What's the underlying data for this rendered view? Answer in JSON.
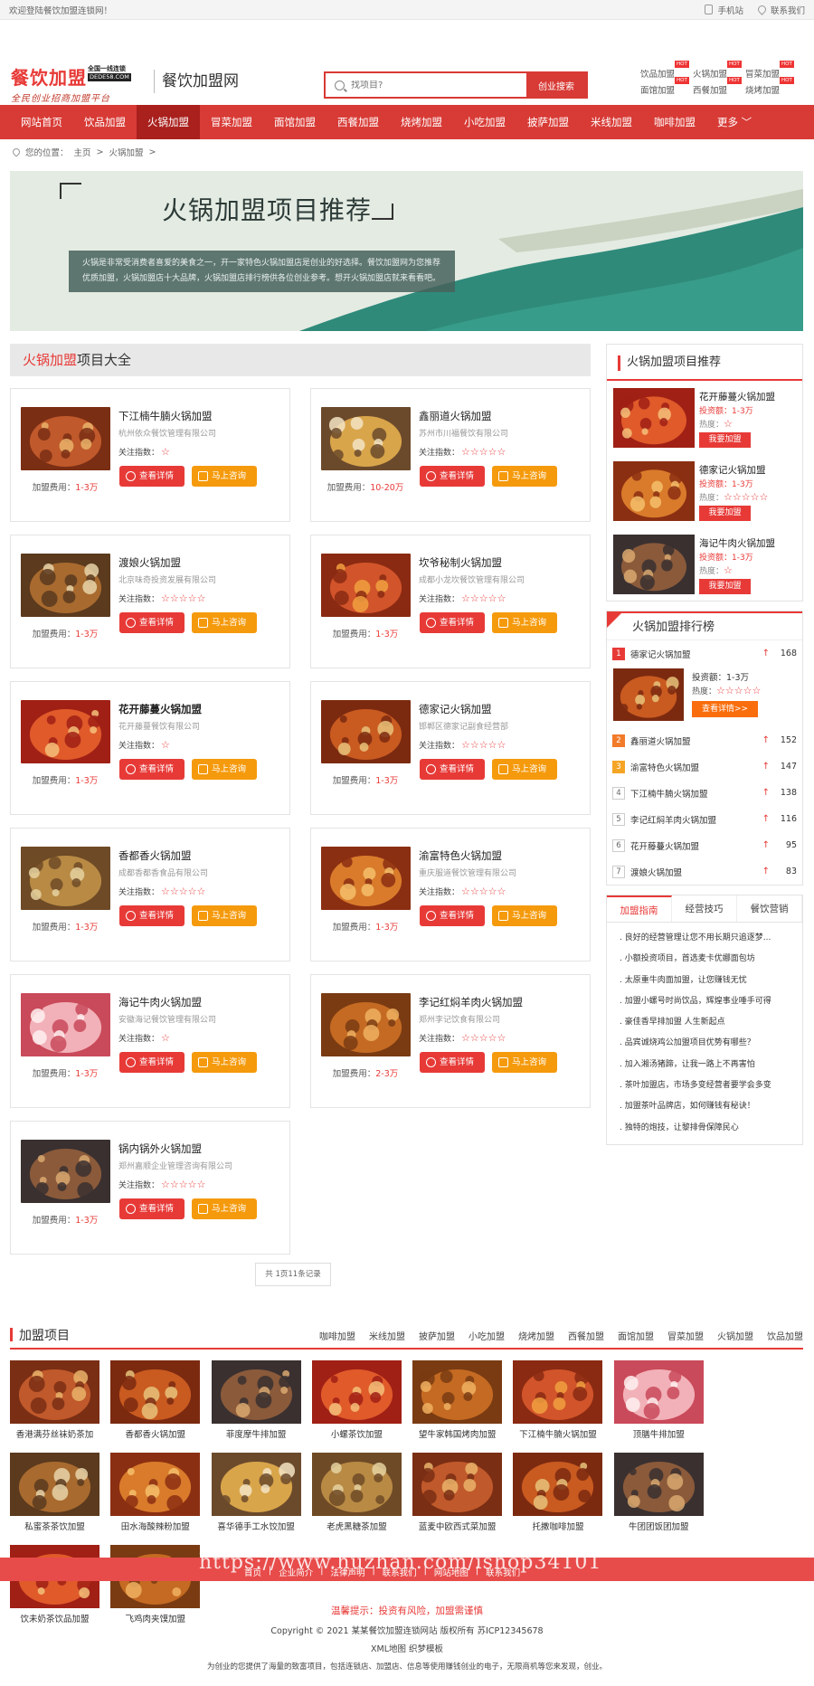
{
  "topbar": {
    "welcome": "欢迎登陆餐饮加盟连锁网！",
    "mobile": "手机站",
    "contact": "联系我们"
  },
  "header": {
    "logo_main": "餐饮加盟",
    "logo_tag1": "全国一线连锁",
    "logo_tag2": "DEDE58.COM",
    "logo_slogan": "全民创业招商加盟平台",
    "site_name": "餐饮加盟网",
    "search_placeholder": "找项目?",
    "search_button": "创业搜索",
    "hot": [
      {
        "label": "饮品加盟",
        "hot": "HOT"
      },
      {
        "label": "火锅加盟",
        "hot": "HOT"
      },
      {
        "label": "冒菜加盟",
        "hot": "HOT"
      },
      {
        "label": "面馆加盟",
        "hot": "HOT"
      },
      {
        "label": "西餐加盟",
        "hot": "HOT"
      },
      {
        "label": "烧烤加盟",
        "hot": "HOT"
      }
    ]
  },
  "nav": [
    {
      "label": "网站首页"
    },
    {
      "label": "饮品加盟"
    },
    {
      "label": "火锅加盟",
      "active": true
    },
    {
      "label": "冒菜加盟"
    },
    {
      "label": "面馆加盟"
    },
    {
      "label": "西餐加盟"
    },
    {
      "label": "烧烤加盟"
    },
    {
      "label": "小吃加盟"
    },
    {
      "label": "披萨加盟"
    },
    {
      "label": "米线加盟"
    },
    {
      "label": "咖啡加盟"
    },
    {
      "label": "更多 ﹀"
    }
  ],
  "breadcrumb": {
    "prefix": "您的位置：",
    "home": "主页",
    "sep": ">",
    "current": "火锅加盟",
    "tail": ">"
  },
  "banner": {
    "title": "火锅加盟项目推荐",
    "desc": "火锅是非常受消费者喜爱的美食之一，开一家特色火锅加盟店是创业的好选择。餐饮加盟网为您推荐优质加盟，火锅加盟店十大品牌，火锅加盟店排行榜供各位创业参考。想开火锅加盟店就来看看吧。"
  },
  "list": {
    "head_red": "火锅加盟",
    "head_rest": "项目大全",
    "attention": "关注指数：",
    "fee_label": "加盟费用：",
    "btn_detail": "查看详情",
    "btn_consult": "马上咨询",
    "items": [
      {
        "name": "下江楠牛腩火锅加盟",
        "company": "杭州依众餐饮管理有限公司",
        "fee": "1-3万",
        "stars": 1,
        "bold": false
      },
      {
        "name": "鑫丽道火锅加盟",
        "company": "苏州市川福餐饮有限公司",
        "fee": "10-20万",
        "stars": 5,
        "bold": false
      },
      {
        "name": "渡娘火锅加盟",
        "company": "北京味奇投资发展有限公司",
        "fee": "1-3万",
        "stars": 5,
        "bold": false
      },
      {
        "name": "坎爷秘制火锅加盟",
        "company": "成都小龙坎餐饮管理有限公司",
        "fee": "1-3万",
        "stars": 5,
        "bold": false
      },
      {
        "name": "花开藤蔓火锅加盟",
        "company": "花开藤蔓餐饮有限公司",
        "fee": "1-3万",
        "stars": 1,
        "bold": true
      },
      {
        "name": "德家记火锅加盟",
        "company": "邯郸区德家记副食经营部",
        "fee": "1-3万",
        "stars": 5,
        "bold": false
      },
      {
        "name": "香都香火锅加盟",
        "company": "成都香都香食品有限公司",
        "fee": "1-3万",
        "stars": 5,
        "bold": false
      },
      {
        "name": "渝富特色火锅加盟",
        "company": "重庆服道餐饮管理有限公司",
        "fee": "1-3万",
        "stars": 5,
        "bold": false
      },
      {
        "name": "海记牛肉火锅加盟",
        "company": "安徽海记餐饮管理有限公司",
        "fee": "1-3万",
        "stars": 1,
        "bold": false
      },
      {
        "name": "李记红焖羊肉火锅加盟",
        "company": "郑州李记饮食有限公司",
        "fee": "2-3万",
        "stars": 5,
        "bold": false
      },
      {
        "name": "锅内锅外火锅加盟",
        "company": "郑州嘉顺企业管理咨询有限公司",
        "fee": "1-3万",
        "stars": 5,
        "bold": false
      }
    ],
    "pager": "共 1页11条记录"
  },
  "recommend": {
    "title": "火锅加盟项目推荐",
    "invest": "投资额：",
    "heat": "热度：",
    "join": "我要加盟",
    "items": [
      {
        "name": "花开藤蔓火锅加盟",
        "amount": "1-3万",
        "stars": 1
      },
      {
        "name": "德家记火锅加盟",
        "amount": "1-3万",
        "stars": 5
      },
      {
        "name": "海记牛肉火锅加盟",
        "amount": "1-3万",
        "stars": 1
      }
    ]
  },
  "ranking": {
    "title": "火锅加盟排行榜",
    "flag": "TOP",
    "feature_invest": "投资额：1-3万",
    "feature_heat": "热度：",
    "feature_btn": "查看详情>>",
    "items": [
      {
        "no": "1",
        "name": "德家记火锅加盟",
        "val": "168"
      },
      {
        "no": "2",
        "name": "鑫丽道火锅加盟",
        "val": "152"
      },
      {
        "no": "3",
        "name": "渝富特色火锅加盟",
        "val": "147"
      },
      {
        "no": "4",
        "name": "下江楠牛腩火锅加盟",
        "val": "138"
      },
      {
        "no": "5",
        "name": "李记红焖羊肉火锅加盟",
        "val": "116"
      },
      {
        "no": "6",
        "name": "花开藤蔓火锅加盟",
        "val": "95"
      },
      {
        "no": "7",
        "name": "渡娘火锅加盟",
        "val": "83"
      }
    ]
  },
  "tabs": {
    "labels": [
      "加盟指南",
      "经营技巧",
      "餐饮营销"
    ],
    "articles": [
      "良好的经营管理让您不用长期只追逐梦...",
      "小额投资项目，首选麦卡优娜面包坊",
      "太原重牛肉面加盟，让您赚钱无忧",
      "加盟小螺号时尚饮品，辉煌事业唾手可得",
      "豪佳香早排加盟 人生新起点",
      "品宾诚烧鸡公加盟项目优势有哪些？",
      "加入湘汤猪蹄，让我一路上不再害怕",
      "茶叶加盟店，市场多变经营者要学会多变",
      "加盟茶叶品牌店，如何赚钱有秘诀！",
      "独特的炮技，让黎排骨保障民心"
    ]
  },
  "bottom": {
    "title": "加盟项目",
    "links": [
      "咖啡加盟",
      "米线加盟",
      "披萨加盟",
      "小吃加盟",
      "烧烤加盟",
      "西餐加盟",
      "面馆加盟",
      "冒菜加盟",
      "火锅加盟",
      "饮品加盟"
    ],
    "items": [
      "香港满芬丝袜奶茶加",
      "香都香火锅加盟",
      "菲度摩牛排加盟",
      "小螺茶饮加盟",
      "望牛家韩国烤肉加盟",
      "下江楠牛腩火锅加盟",
      "顶膳牛排加盟",
      "私蜜茶茶饮加盟",
      "田水海酸辣粉加盟",
      "喜华德手工水饺加盟",
      "老虎黑糖茶加盟",
      "蓝麦中欧西式菜加盟",
      "托撒咖啡加盟",
      "牛团团饭团加盟",
      "饮未奶茶饮品加盟",
      "飞鸡肉夹馍加盟"
    ]
  },
  "footer": {
    "links": [
      "首页",
      "企业简介",
      "法律声明",
      "联系我们",
      "网站地图",
      "联系我们"
    ],
    "watermark": "https://www.huzhan.com/ishop34101",
    "warn": "温馨提示：投资有风险，加盟需谨慎",
    "copyright": "Copyright © 2021 某某餐饮加盟连锁网站 版权所有 苏ICP12345678",
    "xml": "XML地图 织梦模板",
    "note": "为创业的您提供了海量的致富项目，包括连锁店、加盟店、信息等使用赚钱创业的电子，无限商机等您来发现，创业。"
  },
  "colors": {
    "brand": "#d83a35",
    "accent": "#e73a37",
    "orange": "#f59a0c"
  }
}
